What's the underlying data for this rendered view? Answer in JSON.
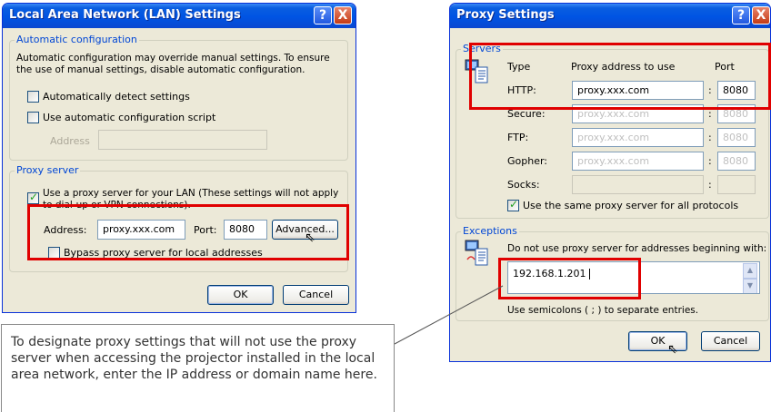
{
  "lan_dialog": {
    "title": "Local Area Network (LAN) Settings",
    "help_label": "?",
    "close_label": "X",
    "auto_config": {
      "legend": "Automatic configuration",
      "description": "Automatic configuration may override manual settings.  To ensure the use of manual settings, disable automatic configuration.",
      "auto_detect_label": "Automatically detect settings",
      "auto_detect_checked": false,
      "script_label": "Use automatic configuration script",
      "script_checked": false,
      "address_label": "Address",
      "address_value": ""
    },
    "proxy": {
      "legend": "Proxy server",
      "use_proxy_label": "Use a proxy server for your LAN (These settings will not apply to dial-up or VPN connections).",
      "use_proxy_checked": true,
      "address_label": "Address:",
      "address_value": "proxy.xxx.com",
      "port_label": "Port:",
      "port_value": "8080",
      "advanced_label": "Advanced...",
      "bypass_label": "Bypass proxy server for local addresses",
      "bypass_checked": false
    },
    "ok_label": "OK",
    "cancel_label": "Cancel"
  },
  "proxy_dialog": {
    "title": "Proxy Settings",
    "help_label": "?",
    "close_label": "X",
    "servers": {
      "legend": "Servers",
      "type_header": "Type",
      "address_header": "Proxy address to use",
      "port_header": "Port",
      "rows": [
        {
          "type": "HTTP:",
          "address": "proxy.xxx.com",
          "port": "8080"
        },
        {
          "type": "Secure:",
          "address": "proxy.xxx.com",
          "port": "8080"
        },
        {
          "type": "FTP:",
          "address": "proxy.xxx.com",
          "port": "8080"
        },
        {
          "type": "Gopher:",
          "address": "proxy.xxx.com",
          "port": "8080"
        },
        {
          "type": "Socks:",
          "address": "",
          "port": ""
        }
      ],
      "colon": ":",
      "same_proxy_label": "Use the same proxy server for all protocols",
      "same_proxy_checked": true
    },
    "exceptions": {
      "legend": "Exceptions",
      "description": "Do not use proxy server for addresses beginning with:",
      "value": "192.168.1.201",
      "hint": "Use semicolons ( ; ) to separate entries."
    },
    "ok_label": "OK",
    "cancel_label": "Cancel"
  },
  "callout": {
    "text": "To designate proxy settings that will not use the proxy server when accessing the projector installed in the local area network, enter the IP address or domain name here."
  },
  "colors": {
    "title_bar": "#0054e3",
    "dialog_bg": "#ece9d8",
    "group_legend": "#0046d5",
    "highlight_box": "#e00000"
  }
}
